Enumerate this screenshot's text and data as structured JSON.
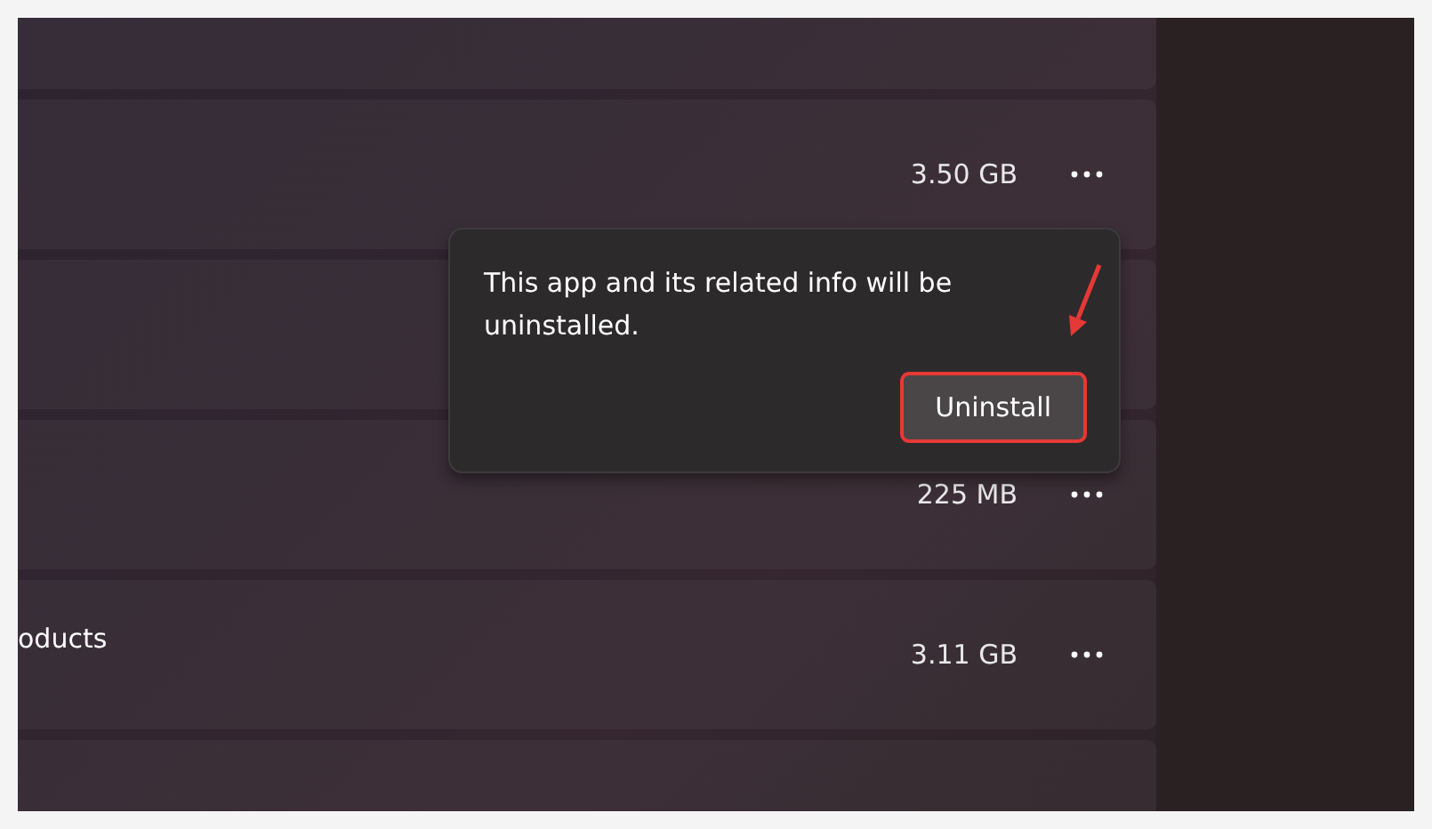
{
  "app_rows": [
    {
      "size": "3.50 GB",
      "more_button": true
    },
    {},
    {
      "size": "225 MB",
      "more_button": true
    },
    {
      "name": "oducts",
      "size": "3.11 GB",
      "more_button": true
    }
  ],
  "uninstall_popup": {
    "message": "This app and its related info will be uninstalled.",
    "button": "Uninstall",
    "button_highlighted": true,
    "arrow": true
  }
}
